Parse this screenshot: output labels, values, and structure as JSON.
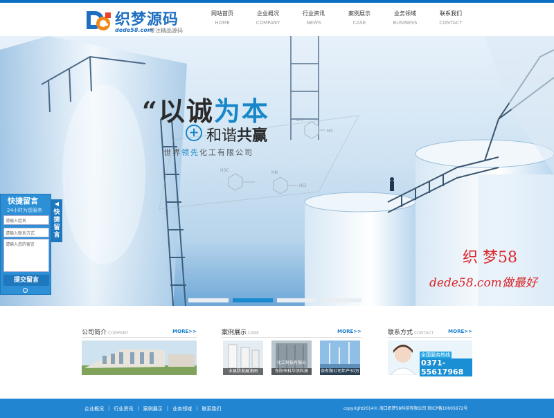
{
  "header": {
    "logo_title": "织梦源码",
    "logo_url": "dede58.com",
    "logo_slogan": "专注精品源码",
    "nav": [
      {
        "cn": "网站首页",
        "en": "HOME"
      },
      {
        "cn": "企业概况",
        "en": "COMPANY"
      },
      {
        "cn": "行业资讯",
        "en": "NEWS"
      },
      {
        "cn": "案例展示",
        "en": "CASE"
      },
      {
        "cn": "业务领域",
        "en": "BUSINESS"
      },
      {
        "cn": "联系我们",
        "en": "CONTACT"
      }
    ]
  },
  "banner": {
    "quote_mark": "“",
    "line1_a": "以诚",
    "line1_b": "为本",
    "plus": "+",
    "line2_a": "和谐",
    "line2_b": "共赢",
    "company_a": "世界",
    "company_hl": "领先",
    "company_b": "化工有限公司",
    "chem_labels": [
      "OH",
      "H3",
      "H3C",
      "HN",
      "HCl"
    ],
    "watermark_1": "织 梦58",
    "watermark_2": "dede58.com做最好",
    "slide_count": 4,
    "active_slide": 2
  },
  "quick_message": {
    "title": "快捷留言",
    "subtitle": "24小时为您服务",
    "name_placeholder": "请输入姓名",
    "contact_placeholder": "请输入联系方式",
    "message_placeholder": "请输入您的留言",
    "submit": "提交留言",
    "tab": "快捷留言"
  },
  "sections": {
    "about": {
      "title": "公司简介",
      "en": "COMPANY",
      "more": "MORE>>"
    },
    "cases": {
      "title": "案例展示",
      "en": "CASE",
      "more": "MORE>>",
      "items": [
        "业县防发展油田",
        "东阳市科华涂料抹",
        "奈有限公司年产30万吨"
      ],
      "item_overlay": "化工科技有限公"
    },
    "contact": {
      "title": "联系方式",
      "en": "CONTACT",
      "more": "MORE>>",
      "hotline_label": "全国服务热线",
      "phone": "0371-55617968"
    }
  },
  "footer": {
    "links": [
      "企业概况",
      "行业资讯",
      "案例展示",
      "业务领域",
      "联系我们"
    ],
    "copyright": "copyright2014© 海口织梦58科技有限公司 琼ICP备10005672号"
  },
  "colors": {
    "brand": "#1a7fcc",
    "footer": "#2285d1",
    "watermark": "#d9262b"
  }
}
